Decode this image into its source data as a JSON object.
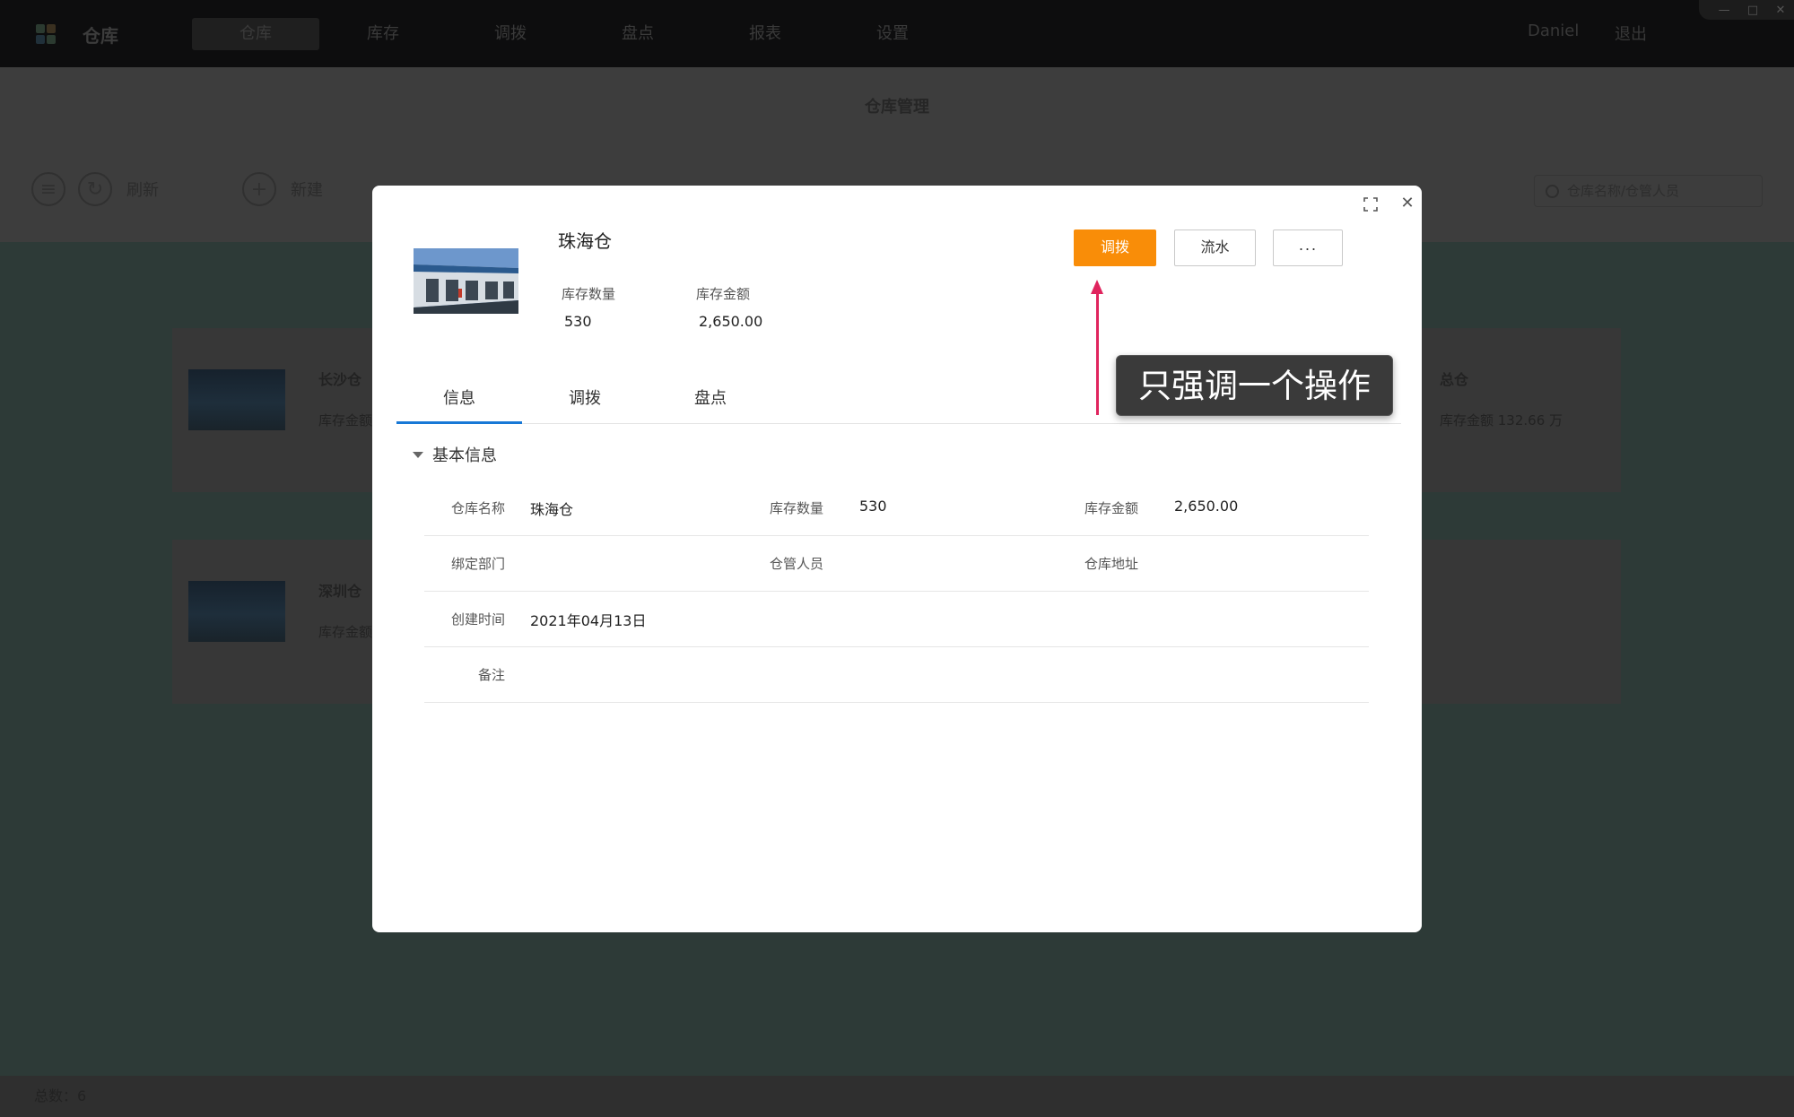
{
  "app": {
    "title": "仓库",
    "nav": [
      "仓库",
      "库存",
      "调拨",
      "盘点",
      "报表",
      "设置"
    ],
    "user": "Daniel",
    "logout": "退出",
    "window_controls": [
      "—",
      "□",
      "✕"
    ]
  },
  "page": {
    "title": "仓库管理",
    "toolbar": {
      "refresh": "刷新",
      "new": "新建"
    },
    "search_placeholder": "仓库名称/仓管人员"
  },
  "background_cards": [
    {
      "name": "长沙仓",
      "amount_label": "库存金额"
    },
    {
      "name": "深圳仓",
      "amount_label": "库存金额"
    }
  ],
  "background_right_card": {
    "name": "总仓",
    "amount": "库存金额 132.66 万"
  },
  "footer": {
    "total": "总数：6"
  },
  "modal": {
    "warehouse_name": "珠海仓",
    "stats": [
      {
        "label": "库存数量",
        "value": "530"
      },
      {
        "label": "库存金额",
        "value": "2,650.00"
      }
    ],
    "buttons": {
      "primary": "调拨",
      "flow": "流水",
      "more": "···"
    },
    "tabs": [
      "信息",
      "调拨",
      "盘点"
    ],
    "active_tab": "信息",
    "section_title": "基本信息",
    "rows": [
      [
        {
          "label": "仓库名称",
          "value": "珠海仓"
        },
        {
          "label": "库存数量",
          "value": "530"
        },
        {
          "label": "库存金额",
          "value": "2,650.00"
        }
      ],
      [
        {
          "label": "绑定部门",
          "value": ""
        },
        {
          "label": "仓管人员",
          "value": ""
        },
        {
          "label": "仓库地址",
          "value": ""
        }
      ],
      [
        {
          "label": "创建时间",
          "value": "2021年04月13日"
        }
      ],
      [
        {
          "label": "备注",
          "value": ""
        }
      ]
    ]
  },
  "annotation": {
    "text": "只强调一个操作",
    "color": "#e0245e"
  },
  "colors": {
    "primary_button": "#f98d08",
    "active_tab": "#1778d6"
  }
}
